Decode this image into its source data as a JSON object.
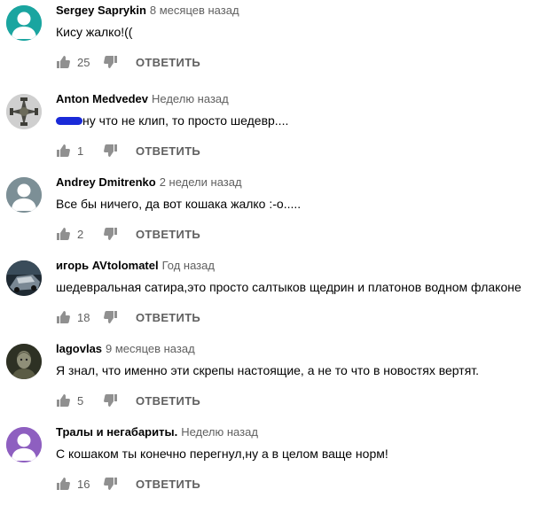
{
  "comments": [
    {
      "author": "Sergey Saprykin",
      "time": "8 месяцев назад",
      "text": "Кису жалко!((",
      "likes": "25",
      "reply": "ОТВЕТИТЬ",
      "avatar_color": "#1aa5a0"
    },
    {
      "author": "Anton Medvedev",
      "time": "Неделю назад",
      "text": "ну что не клип, то просто шедевр....",
      "likes": "1",
      "reply": "ОТВЕТИТЬ",
      "avatar_color": "#8a8a8a"
    },
    {
      "author": "Andrey Dmitrenko",
      "time": "2 недели назад",
      "text": "Все бы ничего, да вот кошака жалко :-о.....",
      "likes": "2",
      "reply": "ОТВЕТИТЬ",
      "avatar_color": "#7c8f96"
    },
    {
      "author": "игорь AVtolomatel",
      "time": "Год назад",
      "text": "шедевральная сатира,это просто салтыков щедрин и платонов  водном флаконе",
      "likes": "18",
      "reply": "ОТВЕТИТЬ",
      "avatar_color": "#2b3a46"
    },
    {
      "author": "lagovlas",
      "time": "9 месяцев назад",
      "text": "Я знал, что именно эти скрепы настоящие, а не то что в новостях вертят.",
      "likes": "5",
      "reply": "ОТВЕТИТЬ",
      "avatar_color": "#3d3f2e"
    },
    {
      "author": "Тралы и негабариты.",
      "time": "Неделю назад",
      "text": "С кошаком ты конечно перегнул,ну а в целом ваще норм!",
      "likes": "16",
      "reply": "ОТВЕТИТЬ",
      "avatar_color": "#8e5fc0"
    }
  ]
}
